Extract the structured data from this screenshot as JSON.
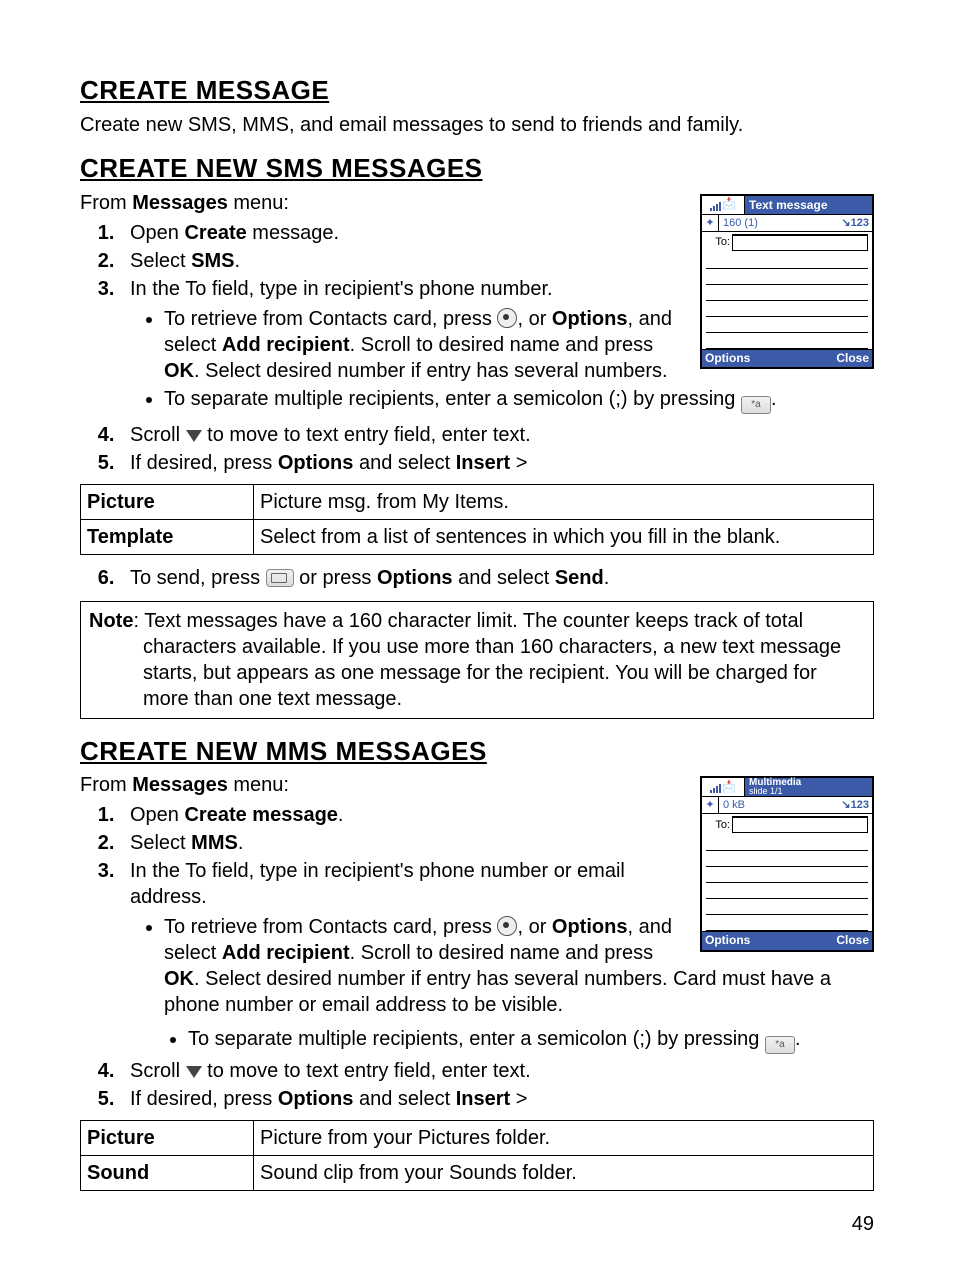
{
  "sections": {
    "s1": {
      "title": "CREATE MESSAGE",
      "intro": "Create new SMS, MMS, and email messages to send to friends and family."
    },
    "s2": {
      "title": "CREATE NEW SMS MESSAGES",
      "from_prefix": "From ",
      "from_bold": "Messages",
      "from_suffix": " menu:",
      "steps": {
        "1a": "Open ",
        "1b": "Create",
        "1c": " message.",
        "2a": "Select ",
        "2b": "SMS",
        "2c": ".",
        "3": "In the To field, type in recipient's phone number.",
        "3_b1a": "To retrieve from Contacts card, press ",
        "3_b1b": ", or ",
        "3_b1c": "Options",
        "3_b1d": ", and select ",
        "3_b1e": "Add recipient",
        "3_b1f": ". Scroll to desired name and press ",
        "3_b1g": "OK",
        "3_b1h": ". Select desired number if entry has several numbers.",
        "3_b2a": "To separate multiple recipients, enter a semicolon (;) by pressing ",
        "3_b2b": ".",
        "4a": "Scroll ",
        "4b": " to move to text entry field, enter text.",
        "5a": "If desired, press ",
        "5b": "Options",
        "5c": " and select ",
        "5d": "Insert",
        "5e": " >",
        "6a": "To send, press ",
        "6b": " or press ",
        "6c": "Options",
        "6d": " and select ",
        "6e": "Send",
        "6f": "."
      },
      "table": {
        "r1c1": "Picture",
        "r1c2": "Picture msg. from My Items.",
        "r2c1": "Template",
        "r2c2": "Select from a list of sentences in which you fill in the blank."
      },
      "note_label": "Note",
      "note_text": ": Text messages have a 160 character limit. The counter keeps track of total characters available. If you use more than 160 characters, a new text message starts, but appears as one message for the recipient. You will be charged for more than one text message."
    },
    "s3": {
      "title": "CREATE NEW MMS MESSAGES",
      "from_prefix": "From ",
      "from_bold": "Messages",
      "from_suffix": " menu:",
      "steps": {
        "1a": "Open ",
        "1b": "Create message",
        "1c": ".",
        "2a": "Select ",
        "2b": "MMS",
        "2c": ".",
        "3": "In the To field, type in recipient's phone number or email address.",
        "3_b1a": "To retrieve from Contacts card, press ",
        "3_b1b": ", or ",
        "3_b1c": "Options",
        "3_b1d": ", and select ",
        "3_b1e": "Add recipient",
        "3_b1f": ". Scroll to desired name and press ",
        "3_b1g": "OK",
        "3_b1h": ". Select desired number if entry has several numbers. Card must have a phone number or email address to be visible.",
        "3_b2a": "To separate multiple recipients, enter a semicolon (;) by pressing ",
        "3_b2b": ".",
        "4a": "Scroll ",
        "4b": " to move to text entry field, enter text.",
        "5a": "If desired, press ",
        "5b": "Options",
        "5c": " and select ",
        "5d": "Insert",
        "5e": " >"
      },
      "table": {
        "r1c1": "Picture",
        "r1c2": "Picture from your Pictures folder.",
        "r2c1": "Sound",
        "r2c2": "Sound clip from your Sounds folder."
      }
    },
    "phone_sms": {
      "title": "Text message",
      "counter": "160 (1)",
      "mode": "↘123",
      "to": "To:",
      "options": "Options",
      "close": "Close"
    },
    "phone_mms": {
      "title": "Multimedia",
      "sub": "slide 1/1",
      "size": "0 kB",
      "mode": "↘123",
      "to": "To:",
      "options": "Options",
      "close": "Close"
    }
  },
  "page_number": "49"
}
